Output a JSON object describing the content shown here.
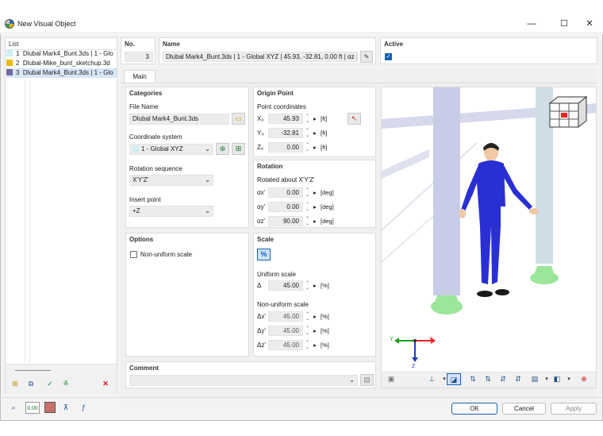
{
  "window": {
    "title": "New Visual Object",
    "minimize": "—",
    "maximize": "☐",
    "close": "✕"
  },
  "list": {
    "header": "List",
    "items": [
      {
        "no": "1",
        "label": "Dlubal Mark4_Bunt.3ds | 1 - Glo",
        "color": "#cdeef3"
      },
      {
        "no": "2",
        "label": "Dlubal-Mike_bunt_sketchup.3d",
        "color": "#f0b800"
      },
      {
        "no": "3",
        "label": "Dlubal Mark4_Bunt.3ds | 1 - Glo",
        "color": "#6f6aa3"
      }
    ]
  },
  "header": {
    "no_label": "No.",
    "no_value": "3",
    "name_label": "Name",
    "name_value": "Dlubal Mark4_Bunt.3ds | 1 - Global XYZ | 45.93, -32.81, 0.00 ft | αz : 9",
    "active_label": "Active",
    "active_checked": true
  },
  "tabs": [
    {
      "label": "Main"
    }
  ],
  "categories": {
    "title": "Categories",
    "file_name_label": "File Name",
    "file_name_value": "Dlubal Mark4_Bunt.3ds",
    "coord_label": "Coordinate system",
    "coord_value": "1 - Global XYZ",
    "rot_seq_label": "Rotation sequence",
    "rot_seq_value": "X'Y'Z'",
    "insert_label": "Insert point",
    "insert_value": "+Z"
  },
  "origin": {
    "title": "Origin Point",
    "coords_label": "Point coordinates",
    "rows": [
      {
        "label": "X₀",
        "value": "45.93",
        "unit": "[ft]"
      },
      {
        "label": "Y₀",
        "value": "-32.81",
        "unit": "[ft]"
      },
      {
        "label": "Z₀",
        "value": "0.00",
        "unit": "[ft]"
      }
    ]
  },
  "rotation": {
    "title": "Rotation",
    "about_label": "Rotated about X'Y'Z'",
    "rows": [
      {
        "label": "αx'",
        "value": "0.00",
        "unit": "[deg]"
      },
      {
        "label": "αy'",
        "value": "0.00",
        "unit": "[deg]"
      },
      {
        "label": "αz'",
        "value": "90.00",
        "unit": "[deg]"
      }
    ]
  },
  "options": {
    "title": "Options",
    "nonuniform_label": "Non-uniform scale",
    "nonuniform_checked": false
  },
  "scale": {
    "title": "Scale",
    "uniform_label": "Uniform scale",
    "uniform_row": {
      "label": "Δ",
      "value": "45.00",
      "unit": "[%]"
    },
    "nonuniform_label": "Non-uniform scale",
    "rows": [
      {
        "label": "Δx'",
        "value": "45.00",
        "unit": "[%]"
      },
      {
        "label": "Δy'",
        "value": "45.00",
        "unit": "[%]"
      },
      {
        "label": "Δz'",
        "value": "45.00",
        "unit": "[%]"
      }
    ]
  },
  "comment": {
    "label": "Comment",
    "value": ""
  },
  "axes": {
    "y": "Y",
    "x": "X",
    "z": "Z"
  },
  "buttons": {
    "ok": "OK",
    "cancel": "Cancel",
    "apply": "Apply"
  },
  "footer_value": "0.00",
  "colors": {
    "accent": "#1760b5",
    "person": "#2a2fd4",
    "column": "#c9cce6",
    "base": "#9be69b"
  }
}
